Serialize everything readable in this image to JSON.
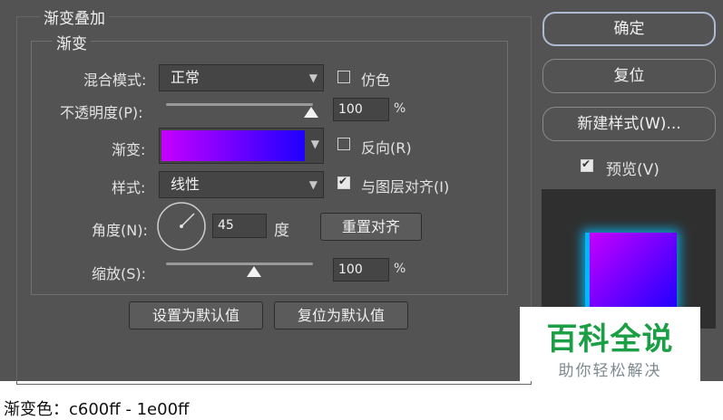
{
  "dialog": {
    "section_title": "渐变叠加",
    "group_title": "渐变",
    "blend_mode": {
      "label": "混合模式:",
      "value": "正常",
      "dither_label": "仿色",
      "dither_checked": false
    },
    "opacity": {
      "label": "不透明度(P):",
      "value": "100",
      "unit": "%",
      "level": 1.0
    },
    "gradient": {
      "label": "渐变:",
      "start_color": "#c600ff",
      "end_color": "#1e00ff",
      "reverse_label": "反向(R)",
      "reverse_checked": false
    },
    "style": {
      "label": "样式:",
      "value": "线性",
      "align_label": "与图层对齐(I)",
      "align_checked": true
    },
    "angle": {
      "label": "角度(N):",
      "value": "45",
      "unit": "度",
      "reset_label": "重置对齐"
    },
    "scale": {
      "label": "缩放(S):",
      "value": "100",
      "unit": "%",
      "level": 0.65
    },
    "make_default_label": "设置为默认值",
    "reset_default_label": "复位为默认值"
  },
  "actions": {
    "ok_label": "确定",
    "reset_label": "复位",
    "new_style_label": "新建样式(W)...",
    "preview_label": "预览(V)",
    "preview_checked": true
  },
  "watermark": {
    "title": "百科全说",
    "subtitle": "助你轻松解决",
    "color": "#1a9f45"
  },
  "caption": "渐变色：c600ff - 1e00ff"
}
